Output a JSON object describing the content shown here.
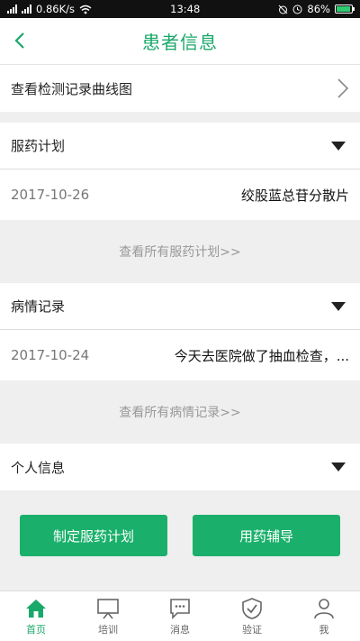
{
  "status": {
    "carrier": "0.86K/s",
    "time": "13:48",
    "battery": "86%"
  },
  "header": {
    "title": "患者信息"
  },
  "curve_link": {
    "label": "查看检测记录曲线图"
  },
  "medication": {
    "title": "服药计划",
    "record": {
      "date": "2017-10-26",
      "text": "绞股蓝总苷分散片"
    },
    "view_all": "查看所有服药计划>>"
  },
  "condition": {
    "title": "病情记录",
    "record": {
      "date": "2017-10-24",
      "text": "今天去医院做了抽血检查，..."
    },
    "view_all": "查看所有病情记录>>"
  },
  "personal": {
    "title": "个人信息"
  },
  "buttons": {
    "plan": "制定服药计划",
    "guide": "用药辅导"
  },
  "tabs": [
    {
      "label": "首页",
      "icon": "home-icon"
    },
    {
      "label": "培训",
      "icon": "presentation-icon"
    },
    {
      "label": "消息",
      "icon": "message-icon"
    },
    {
      "label": "验证",
      "icon": "shield-icon"
    },
    {
      "label": "我",
      "icon": "person-icon"
    }
  ],
  "colors": {
    "accent": "#1aa86a",
    "button": "#1ab06b",
    "background": "#efefef"
  }
}
